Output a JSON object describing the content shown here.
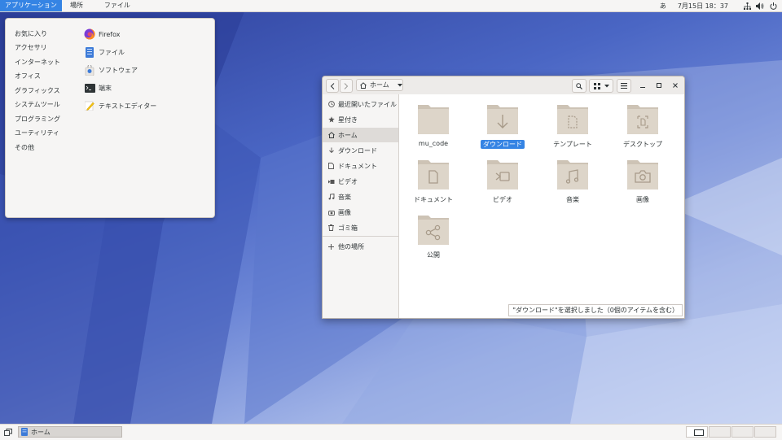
{
  "topbar": {
    "menus": [
      "アプリケーション",
      "場所",
      "ファイル"
    ],
    "input_method": "あ",
    "clock": "7月15日 18：37"
  },
  "app_menu": {
    "categories": [
      "お気に入り",
      "アクセサリ",
      "インターネット",
      "オフィス",
      "グラフィックス",
      "システムツール",
      "プログラミング",
      "ユーティリティ",
      "その他"
    ],
    "apps": [
      {
        "label": "Firefox",
        "icon": "firefox-icon"
      },
      {
        "label": "ファイル",
        "icon": "files-icon"
      },
      {
        "label": "ソフトウェア",
        "icon": "software-icon"
      },
      {
        "label": "端末",
        "icon": "terminal-icon"
      },
      {
        "label": "テキストエディター",
        "icon": "text-editor-icon"
      }
    ]
  },
  "file_manager": {
    "path_label": "ホーム",
    "sidebar": [
      {
        "label": "最近開いたファイル",
        "icon": "clock-icon"
      },
      {
        "label": "星付き",
        "icon": "star-icon"
      },
      {
        "label": "ホーム",
        "icon": "home-icon"
      },
      {
        "label": "ダウンロード",
        "icon": "download-icon"
      },
      {
        "label": "ドキュメント",
        "icon": "document-icon"
      },
      {
        "label": "ビデオ",
        "icon": "video-icon"
      },
      {
        "label": "音楽",
        "icon": "music-icon"
      },
      {
        "label": "画像",
        "icon": "camera-icon"
      },
      {
        "label": "ゴミ箱",
        "icon": "trash-icon"
      },
      {
        "label": "他の場所",
        "icon": "plus-icon"
      }
    ],
    "folders": [
      {
        "label": "mu_code",
        "emblem": "none"
      },
      {
        "label": "ダウンロード",
        "emblem": "download"
      },
      {
        "label": "テンプレート",
        "emblem": "template"
      },
      {
        "label": "デスクトップ",
        "emblem": "desktop"
      },
      {
        "label": "ドキュメント",
        "emblem": "document"
      },
      {
        "label": "ビデオ",
        "emblem": "video"
      },
      {
        "label": "音楽",
        "emblem": "music"
      },
      {
        "label": "画像",
        "emblem": "camera"
      },
      {
        "label": "公開",
        "emblem": "share"
      }
    ],
    "status": "\"ダウンロード\"を選択しました（0個のアイテムを含む）"
  },
  "taskbar": {
    "window_label": "ホーム"
  },
  "colors": {
    "accent": "#3584e4",
    "folder": "#dcd4c8",
    "folder_dark": "#cdc3b5"
  }
}
